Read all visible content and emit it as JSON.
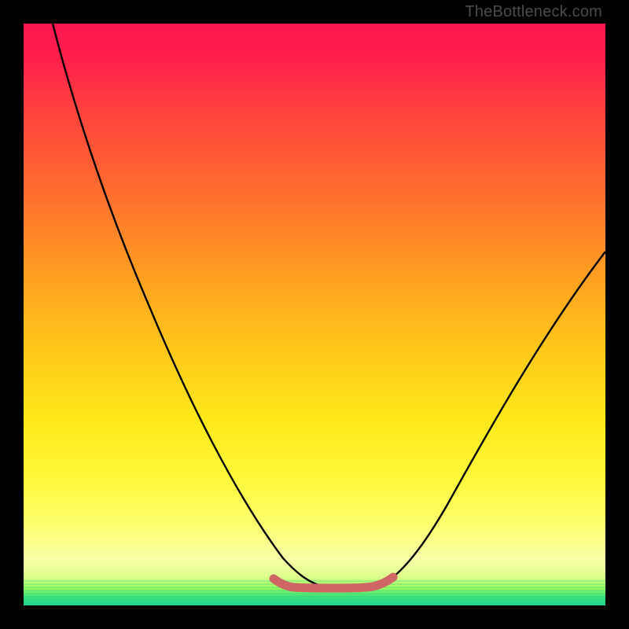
{
  "watermark": "TheBottleneck.com",
  "chart_data": {
    "type": "line",
    "title": "",
    "xlabel": "",
    "ylabel": "",
    "xlim": [
      0,
      100
    ],
    "ylim": [
      0,
      100
    ],
    "grid": false,
    "legend": false,
    "background_gradient": [
      "#ff1750",
      "#ffc81a",
      "#fff83a",
      "#1fd490"
    ],
    "series": [
      {
        "name": "curve",
        "color": "#000000",
        "x": [
          5,
          10,
          15,
          20,
          25,
          30,
          35,
          40,
          45,
          48,
          50,
          52,
          55,
          58,
          60,
          65,
          70,
          75,
          80,
          85,
          90,
          95,
          100
        ],
        "values": [
          100,
          88,
          76,
          65,
          54,
          44,
          34,
          25,
          16,
          10,
          6,
          4,
          3,
          3,
          4,
          7,
          12,
          19,
          27,
          36,
          47,
          55,
          60
        ]
      },
      {
        "name": "bottom-band",
        "color": "#d46a6a",
        "x": [
          45,
          48,
          50,
          52,
          55,
          58,
          60,
          62
        ],
        "values": [
          4,
          3,
          3,
          3,
          3,
          3,
          4,
          5
        ]
      }
    ],
    "annotations": []
  }
}
